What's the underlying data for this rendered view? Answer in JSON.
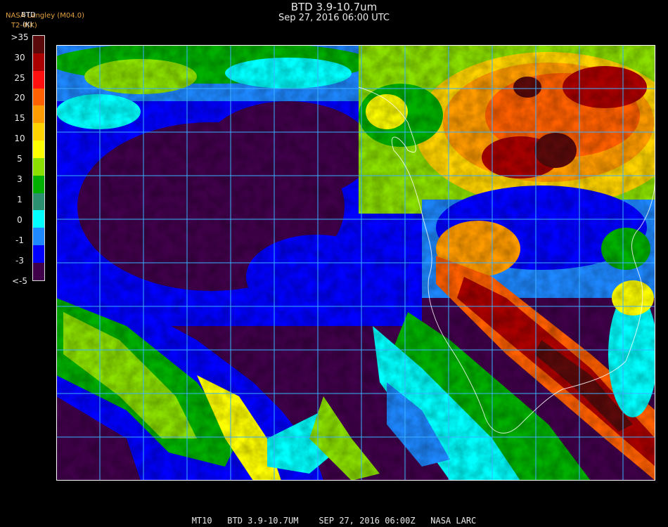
{
  "header": {
    "title": "BTD 3.9-10.7um",
    "datetime": "Sep 27, 2016 06:00 UTC"
  },
  "credit": {
    "source": "NASA Langley (M04.0)",
    "code": "T2-4(K)",
    "overlay1": "BTD",
    "overlay2": "(K)"
  },
  "legend": {
    "labels": [
      ">35",
      "30",
      "25",
      "20",
      "15",
      "10",
      "5",
      "3",
      "1",
      "0",
      "-1",
      "-3",
      "<-5"
    ],
    "colors": [
      "#5a0a0a",
      "#aa0000",
      "#ff1010",
      "#ff6000",
      "#ff9c00",
      "#ffd400",
      "#ffff00",
      "#8ce000",
      "#00b000",
      "#2a9070",
      "#00ffff",
      "#1e88ff",
      "#0000ff",
      "#40004a"
    ]
  },
  "map": {
    "graticule_color": "#3ab0ff",
    "label_color": "#d02020",
    "coast_color": "#ffffff"
  },
  "footer": {
    "text": "MT10   BTD 3.9-10.7UM    SEP 27, 2016 06:00Z   NASA LARC"
  }
}
